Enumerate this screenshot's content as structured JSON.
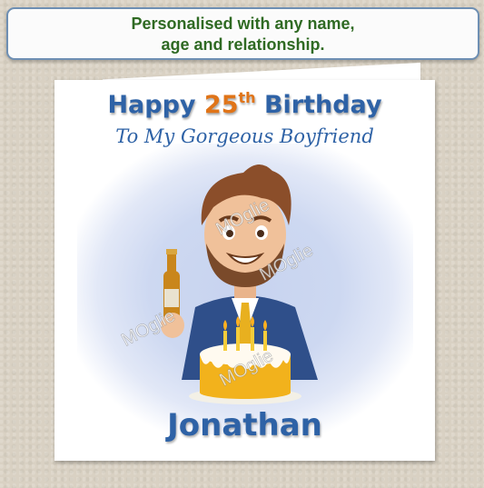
{
  "banner": {
    "line1": "Personalised with any name,",
    "line2": "age and relationship."
  },
  "card": {
    "title_prefix": "Happy ",
    "age_number": "25",
    "age_suffix": "th",
    "title_suffix": " Birthday",
    "subtitle": "To My Gorgeous Boyfriend",
    "name": "Jonathan",
    "watermark": "MOglie"
  },
  "colors": {
    "banner_text": "#2f6a23",
    "banner_border": "#6e8fb3",
    "title_blue": "#2e62a6",
    "age_orange": "#e07418"
  }
}
